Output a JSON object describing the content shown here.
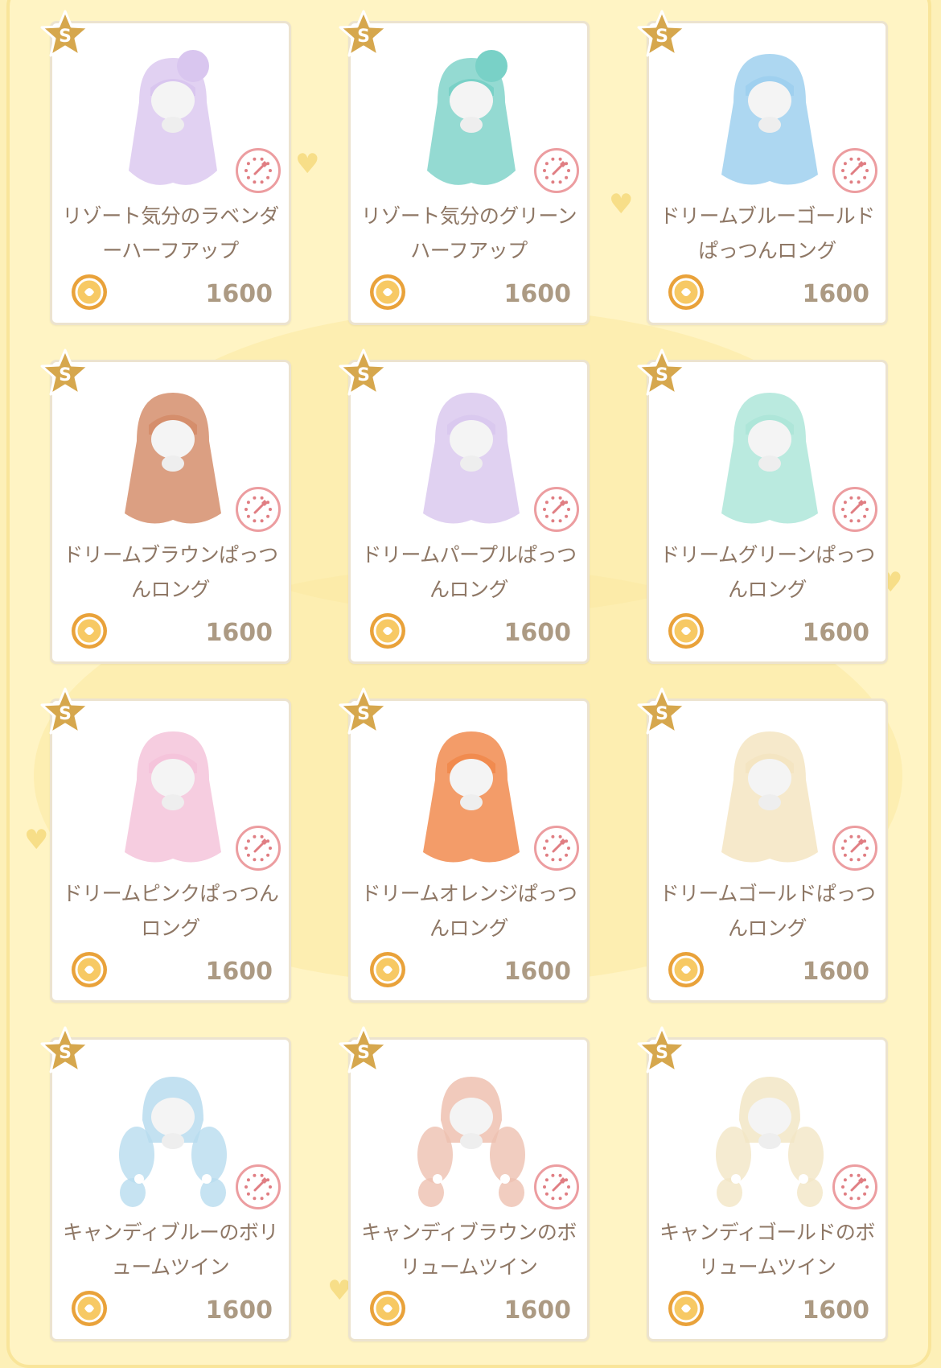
{
  "rank_label": "S",
  "items": [
    {
      "name": "リゾート気分のラベンダーハーフアップ",
      "price": "1600",
      "hair_color": "#d9c6ef",
      "style": "half-up"
    },
    {
      "name": "リゾート気分のグリーンハーフアップ",
      "price": "1600",
      "hair_color": "#79d1c7",
      "style": "half-up"
    },
    {
      "name": "ドリームブルーゴールドぱっつんロング",
      "price": "1600",
      "hair_color": "#9fd0ef",
      "style": "long"
    },
    {
      "name": "ドリームブラウンぱっつんロング",
      "price": "1600",
      "hair_color": "#d58e6c",
      "style": "long"
    },
    {
      "name": "ドリームパープルぱっつんロング",
      "price": "1600",
      "hair_color": "#dac9ef",
      "style": "long"
    },
    {
      "name": "ドリームグリーンぱっつんロング",
      "price": "1600",
      "hair_color": "#aee6d9",
      "style": "long"
    },
    {
      "name": "ドリームピンクぱっつんロング",
      "price": "1600",
      "hair_color": "#f5c4db",
      "style": "long"
    },
    {
      "name": "ドリームオレンジぱっつんロング",
      "price": "1600",
      "hair_color": "#f18b4f",
      "style": "long"
    },
    {
      "name": "ドリームゴールドぱっつんロング",
      "price": "1600",
      "hair_color": "#f4e5c2",
      "style": "long"
    },
    {
      "name": "キャンディブルーのボリュームツイン",
      "price": "1600",
      "hair_color": "#b8dcef",
      "style": "twin"
    },
    {
      "name": "キャンディブラウンのボリュームツイン",
      "price": "1600",
      "hair_color": "#eec1b0",
      "style": "twin"
    },
    {
      "name": "キャンディゴールドのボリュームツイン",
      "price": "1600",
      "hair_color": "#f2e6c6",
      "style": "twin"
    }
  ],
  "colors": {
    "star": "#d6a74d",
    "coin": "#e9a23a",
    "color_button": "#ec9da0",
    "price_text": "#ac9a83",
    "name_text": "#8e7765"
  },
  "icons": {
    "rank": "rank-star-icon",
    "coin": "coin-icon",
    "color_change": "color-dropper-icon"
  }
}
